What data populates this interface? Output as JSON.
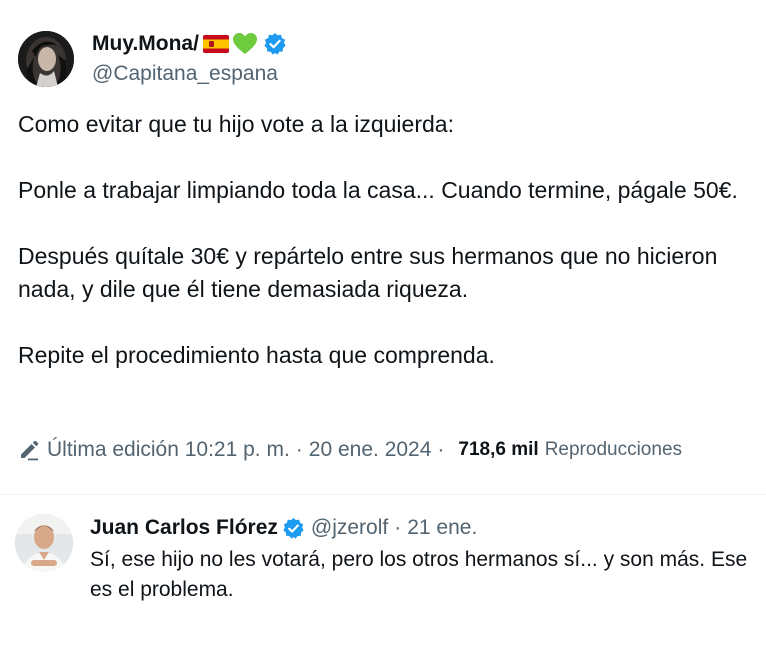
{
  "tweet": {
    "author_name": "Muy.Mona/",
    "author_handle": "@Capitana_espana",
    "paragraphs": [
      "Como evitar que tu hijo vote a la izquierda:",
      "Ponle a trabajar limpiando toda la casa... Cuando termine, págale 50€.",
      "Después quítale 30€ y repártelo entre sus hermanos que no hicieron nada, y dile que él tiene demasiada riqueza.",
      "Repite el procedimiento hasta que comprenda."
    ],
    "edited_label": "Última edición 10:21 p. m.",
    "separator": "·",
    "date": "20 ene. 2024",
    "views_count": "718,6 mil",
    "views_label": "Reproducciones",
    "icons": [
      "spain-flag-icon",
      "green-heart-icon",
      "verified-badge-icon",
      "edit-pencil-icon"
    ]
  },
  "reply": {
    "author_name": "Juan Carlos Flórez",
    "author_handle": "@jzerolf",
    "separator": "·",
    "date": "21 ene.",
    "text": "Sí, ese hijo no les votará, pero los otros hermanos sí... y son más. Ese es el problema."
  },
  "colors": {
    "text_primary": "#0f1419",
    "text_secondary": "#536471",
    "verified_blue": "#1d9bf0",
    "heart_green": "#6ecb3e",
    "divider": "#eff3f4"
  }
}
